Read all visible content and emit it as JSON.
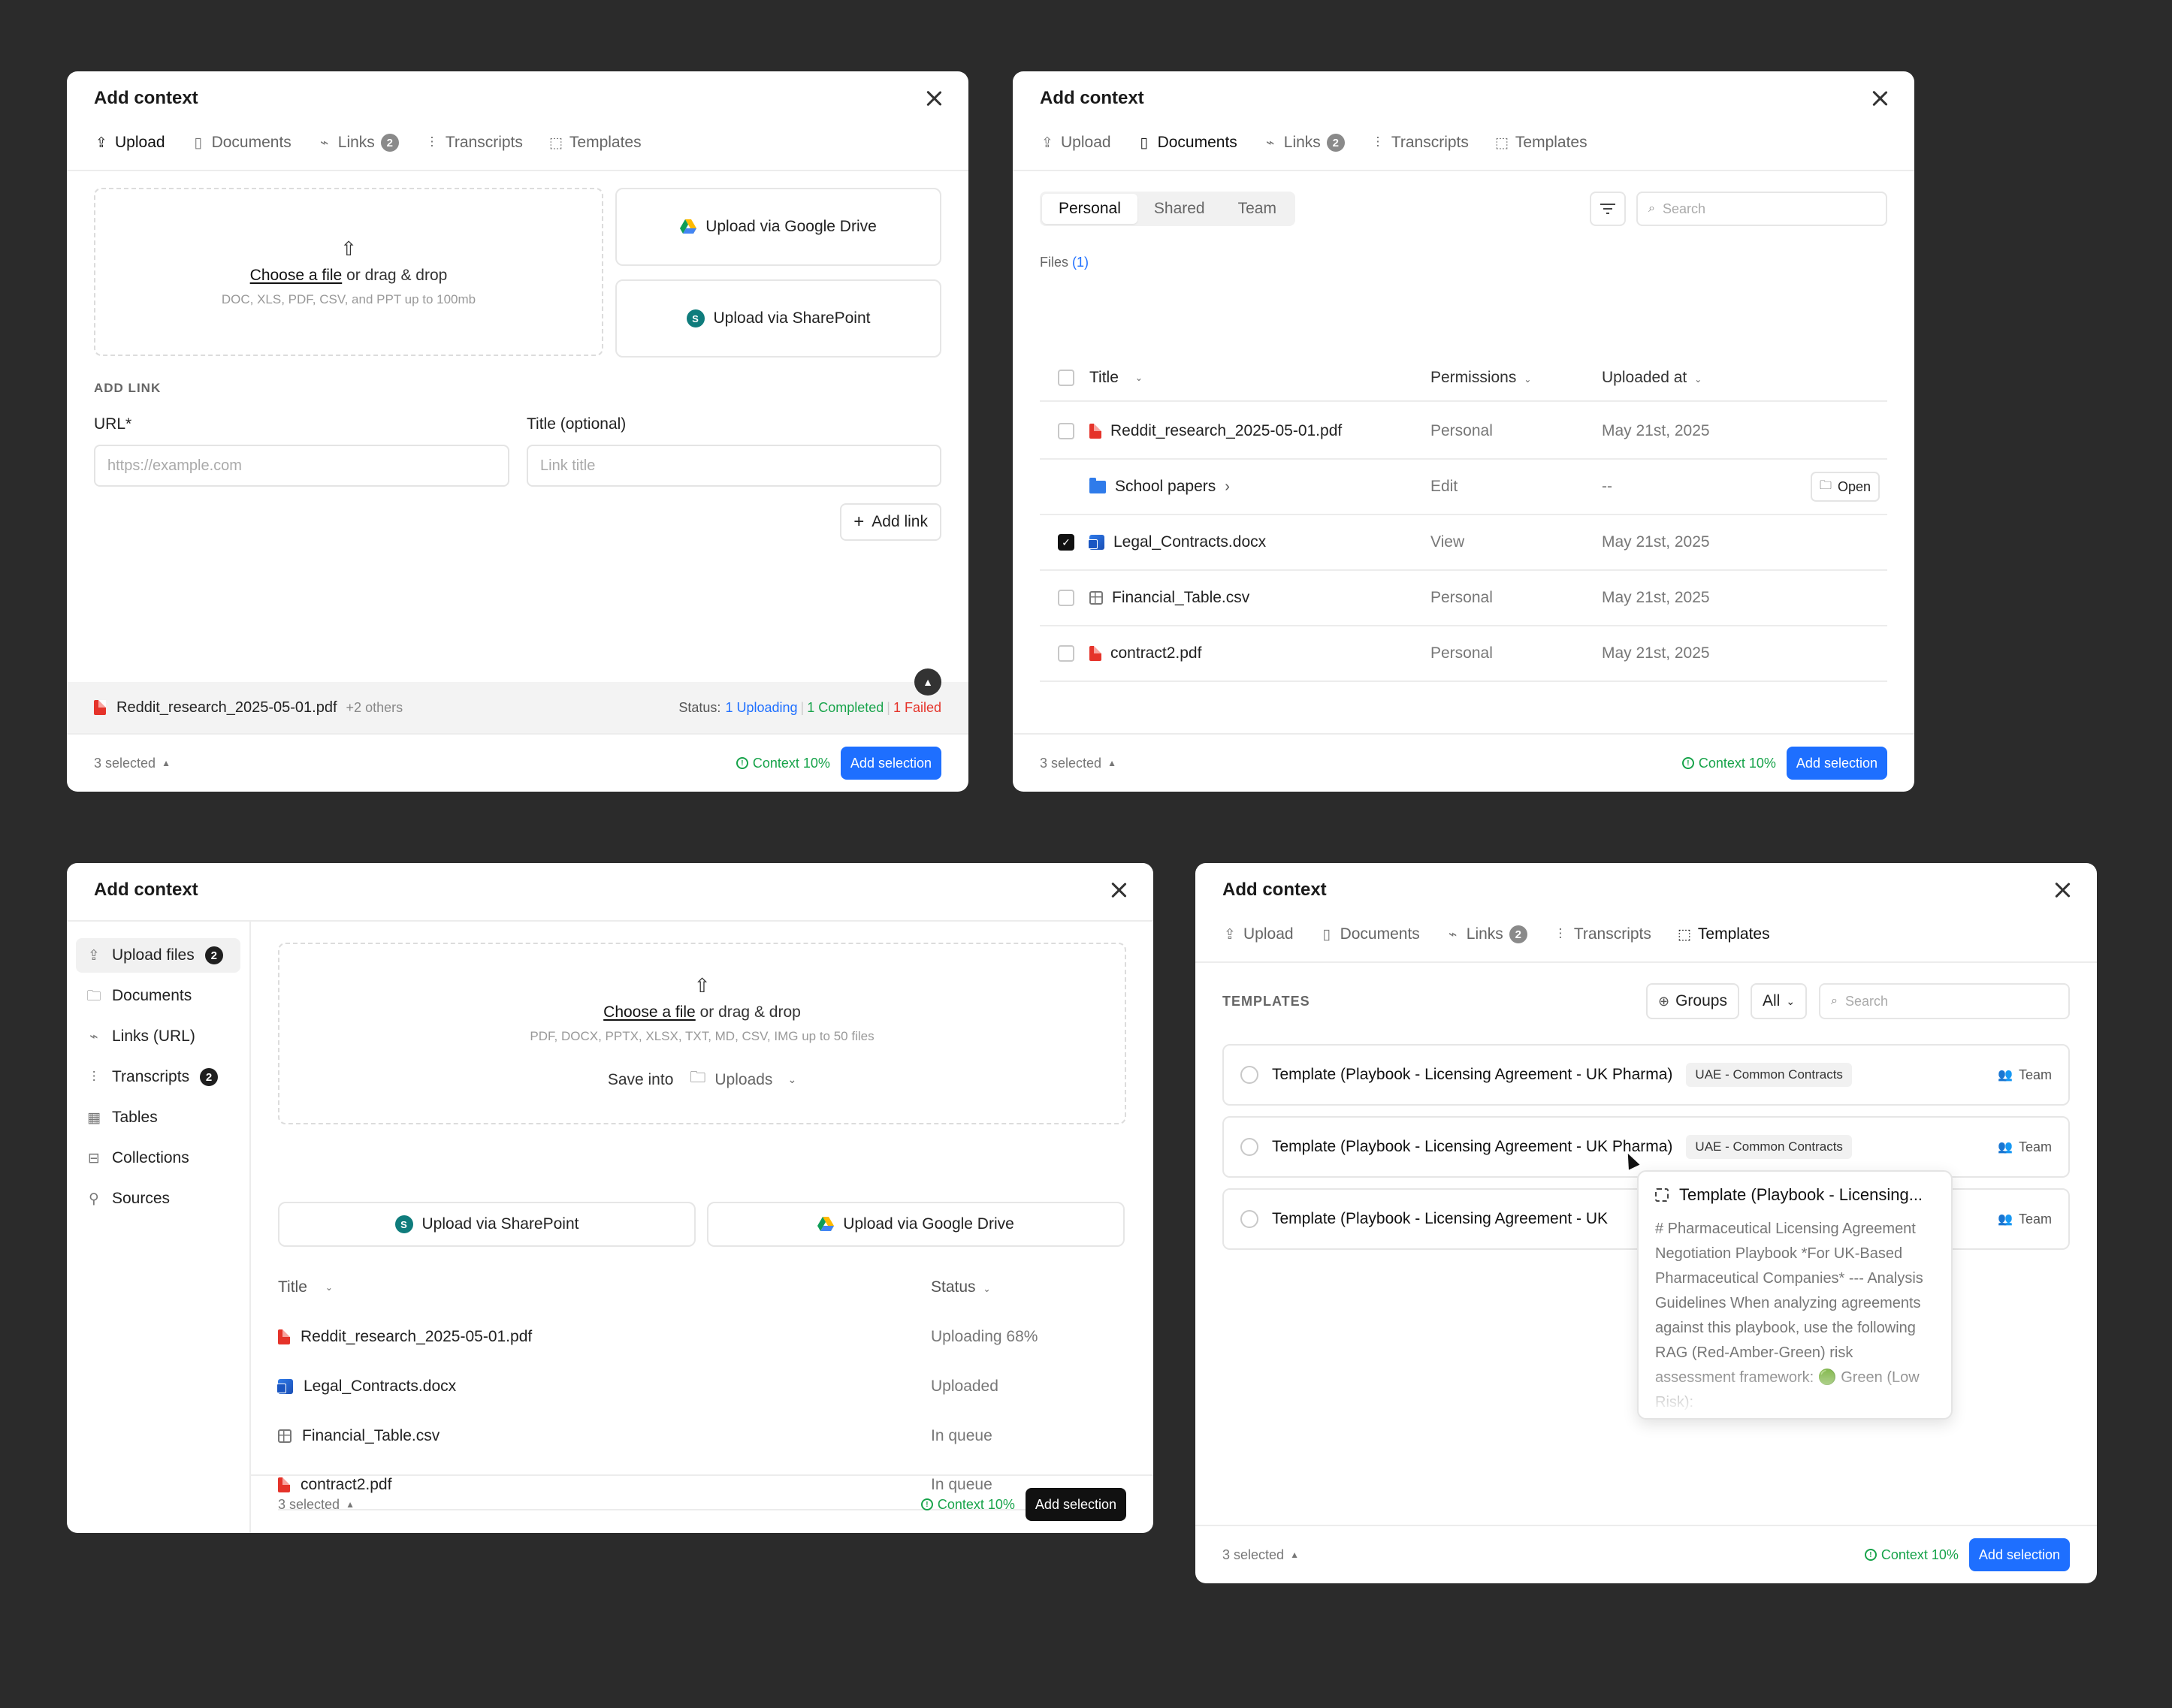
{
  "common": {
    "title": "Add context",
    "selected": "3 selected",
    "context": "Context 10%",
    "add_selection": "Add selection",
    "tabs": {
      "upload": "Upload",
      "documents": "Documents",
      "links": "Links",
      "links_count": "2",
      "transcripts": "Transcripts",
      "templates": "Templates"
    }
  },
  "panel_upload": {
    "dropzone": {
      "choose": "Choose a file",
      "or_drag": " or drag & drop",
      "hint": "DOC, XLS, PDF, CSV, and PPT up to 100mb"
    },
    "google_drive": "Upload via Google Drive",
    "sharepoint": "Upload via SharePoint",
    "add_link_label": "ADD LINK",
    "url_label": "URL*",
    "url_placeholder": "https://example.com",
    "title_label": "Title (optional)",
    "title_placeholder": "Link title",
    "add_link_button": "Add link",
    "status_file": "Reddit_research_2025-05-01.pdf",
    "status_others": "+2 others",
    "status_label": "Status:",
    "status_uploading": "1 Uploading",
    "status_completed": "1 Completed",
    "status_failed": "1 Failed",
    "status_colors": {
      "uploading": "#1e6fff",
      "completed": "#17a34a",
      "failed": "#e5332a"
    }
  },
  "panel_documents": {
    "segments": [
      "Personal",
      "Shared",
      "Team"
    ],
    "search_placeholder": "Search",
    "files_label": "Files",
    "files_count": "(1)",
    "columns": {
      "title": "Title",
      "permissions": "Permissions",
      "uploaded": "Uploaded at"
    },
    "rows": [
      {
        "name": "Reddit_research_2025-05-01.pdf",
        "type": "pdf",
        "permission": "Personal",
        "date": "May 21st, 2025",
        "checked": false
      },
      {
        "name": "School papers",
        "type": "folder",
        "permission": "Edit",
        "date": "--",
        "action": "Open"
      },
      {
        "name": "Legal_Contracts.docx",
        "type": "docx",
        "permission": "View",
        "date": "May 21st, 2025",
        "checked": true
      },
      {
        "name": "Financial_Table.csv",
        "type": "csv",
        "permission": "Personal",
        "date": "May 21st, 2025",
        "checked": false
      },
      {
        "name": "contract2.pdf",
        "type": "pdf",
        "permission": "Personal",
        "date": "May 21st, 2025",
        "checked": false
      }
    ]
  },
  "panel_sidebar": {
    "sidebar": [
      {
        "label": "Upload files",
        "badge": "2",
        "icon": "upload-icon"
      },
      {
        "label": "Documents",
        "icon": "document-icon"
      },
      {
        "label": "Links (URL)",
        "icon": "link-icon"
      },
      {
        "label": "Transcripts",
        "badge": "2",
        "icon": "waveform-icon"
      },
      {
        "label": "Tables",
        "icon": "table-icon"
      },
      {
        "label": "Collections",
        "icon": "collection-icon"
      },
      {
        "label": "Sources",
        "icon": "sources-icon"
      }
    ],
    "dropzone": {
      "choose": "Choose a file",
      "or_drag": " or drag & drop",
      "hint": "PDF, DOCX, PPTX, XLSX, TXT, MD, CSV, IMG up to 50 files"
    },
    "save_into_label": "Save into",
    "save_into_value": "Uploads",
    "sharepoint": "Upload via SharePoint",
    "google_drive": "Upload via Google Drive",
    "columns": {
      "title": "Title",
      "status": "Status"
    },
    "rows": [
      {
        "name": "Reddit_research_2025-05-01.pdf",
        "type": "pdf",
        "status": "Uploading 68%"
      },
      {
        "name": "Legal_Contracts.docx",
        "type": "docx",
        "status": "Uploaded"
      },
      {
        "name": "Financial_Table.csv",
        "type": "csv",
        "status": "In queue"
      },
      {
        "name": "contract2.pdf",
        "type": "pdf",
        "status": "In queue"
      }
    ]
  },
  "panel_templates": {
    "section_label": "TEMPLATES",
    "groups_button": "Groups",
    "filter_value": "All",
    "search_placeholder": "Search",
    "rows": [
      {
        "name": "Template (Playbook - Licensing Agreement - UK Pharma)",
        "tag": "UAE - Common Contracts",
        "scope": "Team"
      },
      {
        "name": "Template (Playbook - Licensing Agreement - UK Pharma)",
        "tag": "UAE - Common Contracts",
        "scope": "Team"
      },
      {
        "name": "Template (Playbook - Licensing Agreement - UK",
        "tag": "",
        "scope": "Team"
      }
    ],
    "popover": {
      "title": "Template (Playbook - Licensing...",
      "body": "# Pharmaceutical Licensing Agreement Negotiation Playbook *For UK-Based Pharmaceutical Companies* --- Analysis Guidelines When analyzing agreements against this playbook, use the following RAG (Red-Amber-Green) risk assessment framework: 🟢 Green (Low Risk):"
    }
  }
}
